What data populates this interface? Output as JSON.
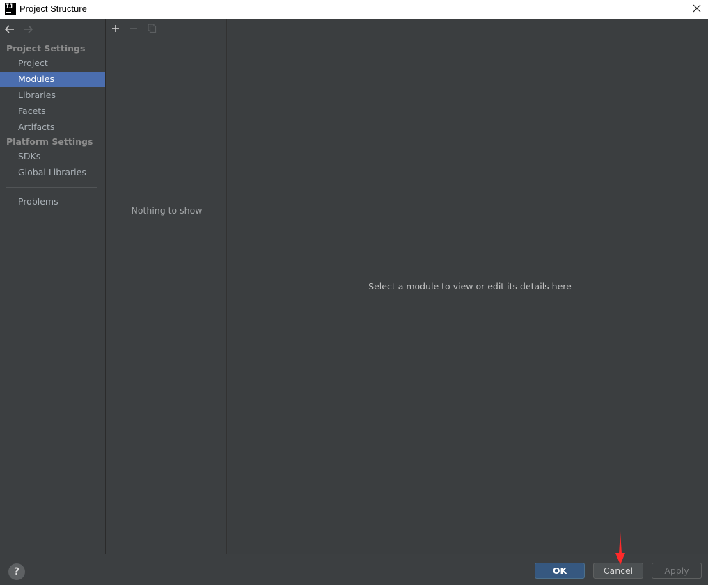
{
  "window": {
    "title": "Project Structure",
    "logo_text": "IJ"
  },
  "navigation": {
    "back_icon": "arrow-left-icon",
    "forward_icon": "arrow-right-icon",
    "sections": [
      {
        "header": "Project Settings",
        "items": [
          "Project",
          "Modules",
          "Libraries",
          "Facets",
          "Artifacts"
        ]
      },
      {
        "header": "Platform Settings",
        "items": [
          "SDKs",
          "Global Libraries"
        ]
      }
    ],
    "extra_items": [
      "Problems"
    ],
    "selected": "Modules"
  },
  "list_panel": {
    "toolbar": [
      "add-icon",
      "remove-icon",
      "copy-icon"
    ],
    "empty_text": "Nothing to show"
  },
  "details_panel": {
    "hint": "Select a module to view or edit its details here"
  },
  "footer": {
    "help_label": "?",
    "ok_label": "OK",
    "cancel_label": "Cancel",
    "apply_label": "Apply"
  },
  "colors": {
    "background": "#3c3f41",
    "selection": "#4b6eaf",
    "primary_button": "#365880",
    "annotation_arrow": "#ff2a2a"
  }
}
